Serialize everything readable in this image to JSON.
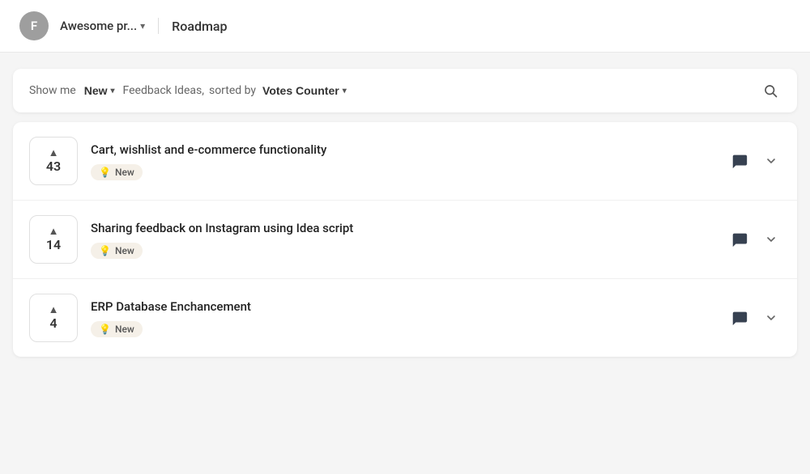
{
  "header": {
    "avatar_initial": "F",
    "workspace_name": "Awesome pr...",
    "workspace_chevron": "▾",
    "separator": true,
    "roadmap_label": "Roadmap"
  },
  "filter_bar": {
    "show_me_label": "Show me",
    "filter_value": "New",
    "filter_chevron": "▾",
    "ideas_text": "Feedback Ideas,",
    "sorted_by_label": "sorted by",
    "sort_value": "Votes Counter",
    "sort_chevron": "▾",
    "search_icon": "🔍"
  },
  "ideas": [
    {
      "id": 1,
      "title": "Cart, wishlist and e-commerce functionality",
      "votes": 43,
      "badge": "New"
    },
    {
      "id": 2,
      "title": "Sharing feedback on Instagram using Idea script",
      "votes": 14,
      "badge": "New"
    },
    {
      "id": 3,
      "title": "ERP Database Enchancement",
      "votes": 4,
      "badge": "New"
    }
  ]
}
